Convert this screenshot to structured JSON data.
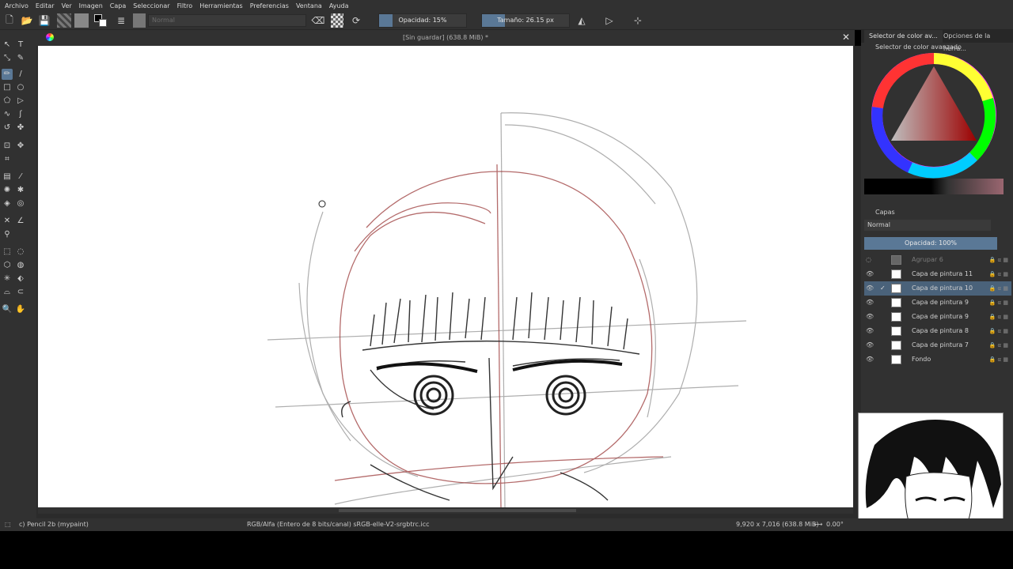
{
  "menu": [
    "Archivo",
    "Editar",
    "Ver",
    "Imagen",
    "Capa",
    "Seleccionar",
    "Filtro",
    "Herramientas",
    "Preferencias",
    "Ventana",
    "Ayuda"
  ],
  "toolbar": {
    "blend_mode": "Normal",
    "opacity_label": "Opacidad: 15%",
    "size_label": "Tamaño: 26.15 px"
  },
  "document": {
    "title": "[Sin guardar]  (638.8 MiB) *"
  },
  "dock": {
    "tab_color": "Selector de color av...",
    "tab_tool_options": "Opciones de la herra...",
    "color_panel_title": "Selector de color avanzado",
    "layers_panel_title": "Capas",
    "layers_blend_mode": "Normal",
    "layers_opacity": "Opacidad:  100%"
  },
  "layers": [
    {
      "name": "Agrupar 6",
      "visible": false,
      "selected": false
    },
    {
      "name": "Capa de pintura 11",
      "visible": true,
      "selected": false
    },
    {
      "name": "Capa de pintura 10",
      "visible": true,
      "selected": true
    },
    {
      "name": "Capa de pintura 9",
      "visible": true,
      "selected": false
    },
    {
      "name": "Capa de pintura 9",
      "visible": true,
      "selected": false
    },
    {
      "name": "Capa de pintura 8",
      "visible": true,
      "selected": false
    },
    {
      "name": "Capa de pintura 7",
      "visible": true,
      "selected": false
    },
    {
      "name": "Fondo",
      "visible": true,
      "selected": false
    }
  ],
  "status": {
    "brush": "c) Pencil 2b (mypaint)",
    "color_space": "RGB/Alfa (Entero de 8 bits/canal)  sRGB-elle-V2-srgbtrc.icc",
    "dimensions": "9,920 x 7,016 (638.8 MiB)",
    "rotation": "0.00°"
  },
  "colors": {
    "accent": "#5a7896",
    "sketch_red": "#9b3a3a",
    "panel": "#313131"
  }
}
